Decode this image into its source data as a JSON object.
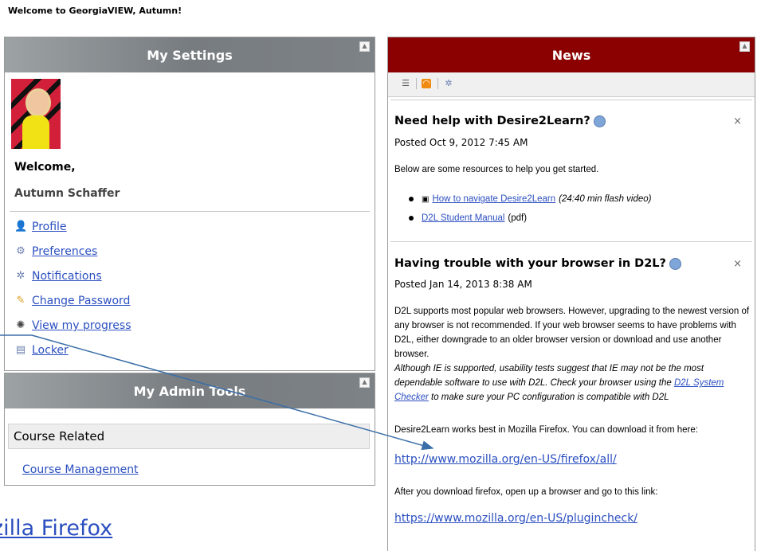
{
  "banner": "Welcome to GeorgiaVIEW, Autumn!",
  "settings": {
    "title": "My Settings",
    "welcome": "Welcome,",
    "name": "Autumn Schaffer",
    "items": [
      {
        "label": "Profile",
        "icon": "person-icon"
      },
      {
        "label": "Preferences",
        "icon": "preferences-icon"
      },
      {
        "label": "Notifications",
        "icon": "notifications-icon"
      },
      {
        "label": "Change Password",
        "icon": "key-icon"
      },
      {
        "label": "View my progress",
        "icon": "progress-icon"
      },
      {
        "label": "Locker",
        "icon": "locker-icon"
      }
    ]
  },
  "admin": {
    "title": "My Admin Tools",
    "section": "Course Related",
    "link": "Course Management"
  },
  "news": {
    "title": "News",
    "items": [
      {
        "title": "Need help with Desire2Learn?",
        "posted": "Posted Oct 9, 2012 7:45 AM",
        "intro": "Below are some resources to help you get started.",
        "link1": "How to navigate Desire2Learn",
        "link1_note": "(24:40 min flash video)",
        "link2": "D2L Student Manual",
        "link2_note": "(pdf)"
      },
      {
        "title": "Having trouble with your browser in D2L?",
        "posted": "Posted Jan 14, 2013 8:38 AM",
        "para1": "D2L supports most popular web browsers. However, upgrading to the newest version of any browser is not recommended.  If your web browser seems to have problems with D2L, either downgrade to an older browser version or download and use another browser.",
        "para2_a": "Although IE is supported, usability tests suggest that IE may not be the most dependable software to use with D2L. Check your browser using the ",
        "para2_link": "D2L System Checker",
        "para2_b": " to make sure your PC configuration is compatible with D2L",
        "para3": "Desire2Learn works best in Mozilla Firefox. You can download it from here:",
        "url1": "http://www.mozilla.org/en-US/firefox/all/",
        "para4": "After you download firefox, open up a browser and go to this link:",
        "url2": "https://www.mozilla.org/en-US/plugincheck/"
      }
    ]
  },
  "slide_text": "zilla Firefox",
  "annotation_color": "#3b6ea8"
}
